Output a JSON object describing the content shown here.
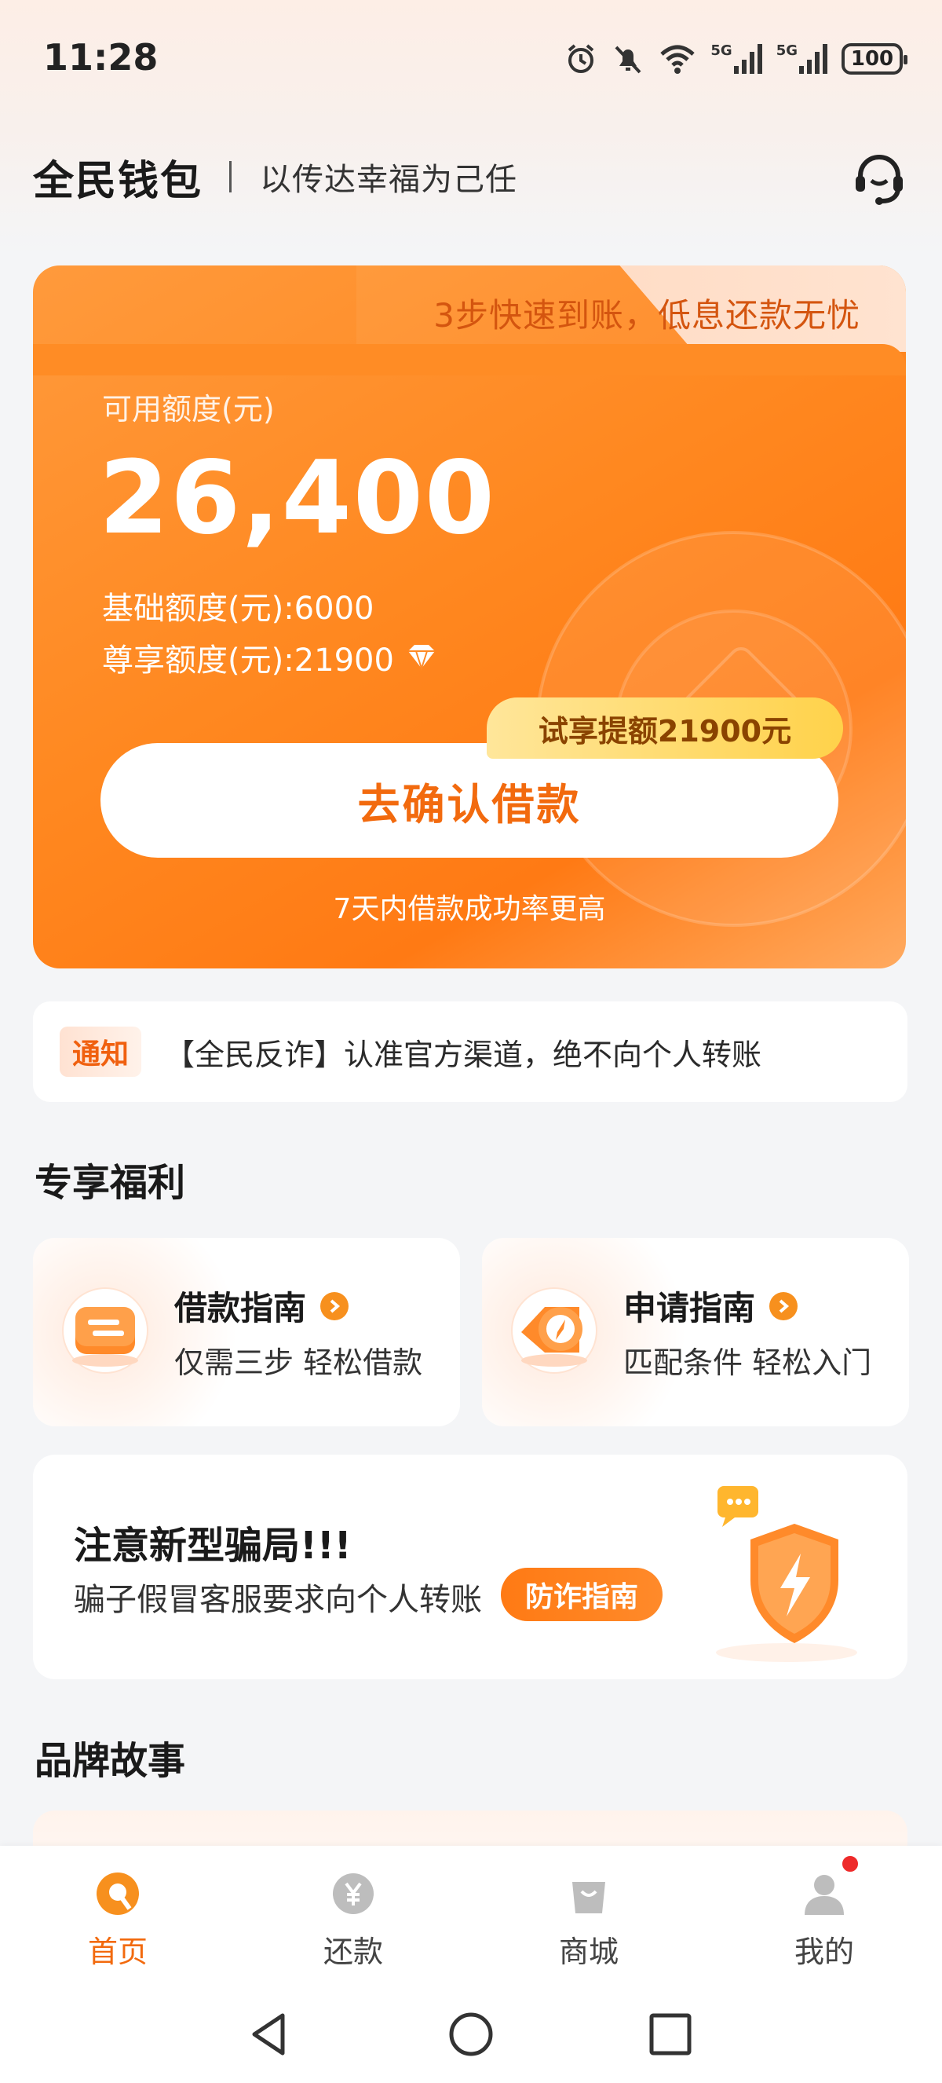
{
  "status_bar": {
    "time": "11:28",
    "signal_1": "5G",
    "signal_2": "5G",
    "battery": "100"
  },
  "header": {
    "brand": "全民钱包",
    "slogan": "以传达幸福为己任"
  },
  "hero": {
    "tab_text": "3步快速到账，低息还款无忧",
    "available_label": "可用额度(元)",
    "available_amount": "26,400",
    "base_credit": "基础额度(元):6000",
    "vip_credit": "尊享额度(元):21900",
    "trial_badge": "试享提额21900元",
    "confirm_button": "去确认借款",
    "tip": "7天内借款成功率更高"
  },
  "notice": {
    "tag": "通知",
    "text": "【全民反诈】认准官方渠道，绝不向个人转账"
  },
  "benefits": {
    "title": "专享福利",
    "cards": [
      {
        "title": "借款指南",
        "subtitle": "仅需三步 轻松借款"
      },
      {
        "title": "申请指南",
        "subtitle": "匹配条件 轻松入门"
      }
    ]
  },
  "scam": {
    "title": "注意新型骗局!!!",
    "subtitle": "骗子假冒客服要求向个人转账",
    "button": "防诈指南"
  },
  "story": {
    "title": "品牌故事"
  },
  "bottom_nav": {
    "items": [
      {
        "label": "首页",
        "active": true
      },
      {
        "label": "还款",
        "active": false
      },
      {
        "label": "商城",
        "active": false
      },
      {
        "label": "我的",
        "active": false
      }
    ]
  },
  "colors": {
    "accent": "#f26a0e",
    "hero_start": "#ff9a3c",
    "hero_end": "#ff7a14",
    "badge": "#ffd24a",
    "red_dot": "#ee2a2a"
  }
}
